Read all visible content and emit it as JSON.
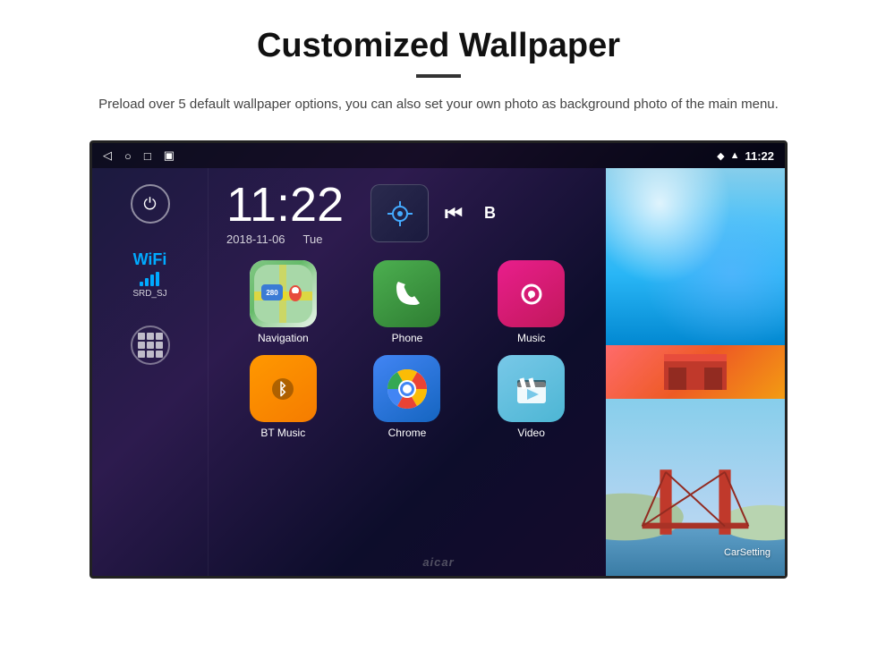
{
  "header": {
    "title": "Customized Wallpaper",
    "description": "Preload over 5 default wallpaper options, you can also set your own photo as background photo of the main menu."
  },
  "statusbar": {
    "time": "11:22",
    "nav_icons": [
      "◁",
      "○",
      "□",
      "⊞"
    ],
    "right_icons": [
      "location",
      "wifi",
      "signal"
    ]
  },
  "clock": {
    "time": "11:22",
    "date": "2018-11-06",
    "day": "Tue"
  },
  "wifi": {
    "label": "WiFi",
    "network": "SRD_SJ"
  },
  "apps": [
    {
      "name": "Navigation",
      "icon_type": "navigation"
    },
    {
      "name": "Phone",
      "icon_type": "phone"
    },
    {
      "name": "Music",
      "icon_type": "music"
    },
    {
      "name": "BT Music",
      "icon_type": "btmusic"
    },
    {
      "name": "Chrome",
      "icon_type": "chrome"
    },
    {
      "name": "Video",
      "icon_type": "video"
    }
  ],
  "sidebar_labels": {
    "wifi": "WiFi",
    "network_name": "SRD_SJ",
    "car_setting": "CarSetting"
  },
  "watermark": "aicar",
  "route_label": "280 Navigation"
}
